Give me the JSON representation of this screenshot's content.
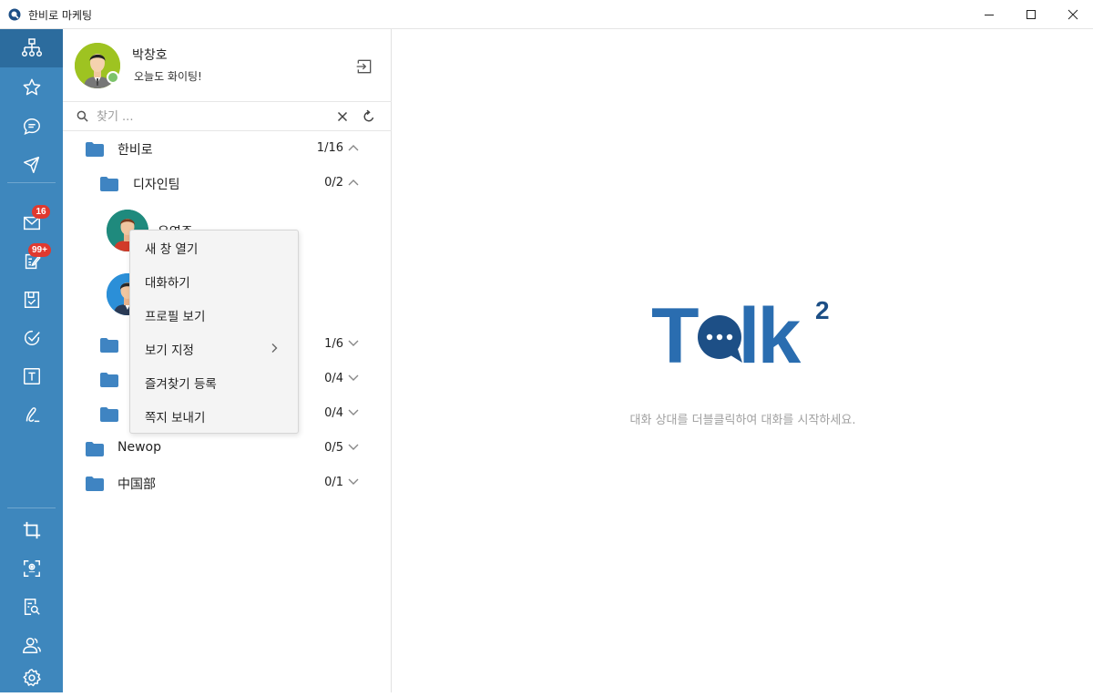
{
  "window": {
    "title": "한비로 마케팅"
  },
  "rail": {
    "mail_badge": "16",
    "board_badge": "99+"
  },
  "profile": {
    "name": "박창호",
    "status_message": "오늘도 화이팅!"
  },
  "search": {
    "placeholder": "찾기 ..."
  },
  "tree": {
    "root": {
      "label": "한비로",
      "count": "1/16"
    },
    "design": {
      "label": "디자인팀",
      "count": "0/2"
    },
    "person1": {
      "name": "유영주"
    },
    "group3": {
      "count": "1/6"
    },
    "group4": {
      "count": "0/4"
    },
    "group5": {
      "count": "0/4"
    },
    "newop": {
      "label": "Newop",
      "count": "0/5"
    },
    "china": {
      "label": "中国部",
      "count": "0/1"
    }
  },
  "context_menu": {
    "items": [
      "새 창 열기",
      "대화하기",
      "프로필 보기",
      "보기 지정",
      "즐겨찾기 등록",
      "쪽지 보내기"
    ]
  },
  "main": {
    "logo_text": "Talk",
    "logo_superscript": "2",
    "hint": "대화 상대를 더블클릭하여 대화를 시작하세요."
  },
  "colors": {
    "rail": "#3e87bd",
    "rail_active": "#2c6c9e",
    "accent": "#2a6db0",
    "logo_dark": "#1d4f86",
    "badge": "#e0392f",
    "folder": "#3f84c2"
  }
}
